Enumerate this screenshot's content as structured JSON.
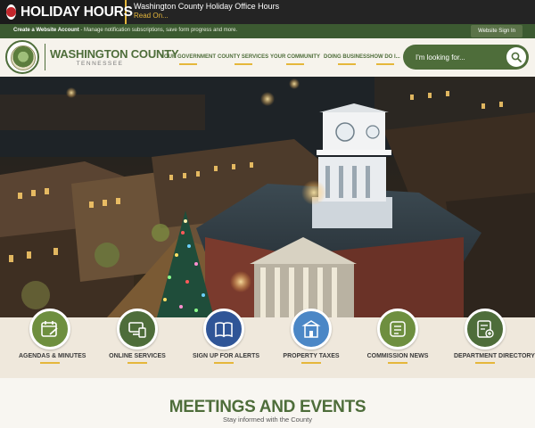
{
  "alert": {
    "title": "HOLIDAY HOURS",
    "message": "Washington County Holiday Office Hours",
    "link": "Read On..."
  },
  "account_bar": {
    "cta": "Create a Website Account",
    "message": " - Manage notification subscriptions, save form progress and more.",
    "signin": "Website Sign In"
  },
  "logo": {
    "name": "WASHINGTON COUNTY",
    "state": "TENNESSEE",
    "seal_icon": "county-seal-icon"
  },
  "nav": [
    "YOUR GOVERNMENT",
    "COUNTY SERVICES",
    "YOUR COMMUNITY",
    "DOING BUSINESS",
    "HOW DO I..."
  ],
  "search": {
    "placeholder": "I'm looking for...",
    "icon": "search-icon"
  },
  "quick_links": [
    {
      "label": "AGENDAS & MINUTES",
      "icon": "calendar-edit-icon",
      "color": "#6e8f3f"
    },
    {
      "label": "ONLINE SERVICES",
      "icon": "online-services-icon",
      "color": "#4e6d3a"
    },
    {
      "label": "SIGN UP FOR ALERTS",
      "icon": "book-icon",
      "color": "#2f5597"
    },
    {
      "label": "PROPERTY TAXES",
      "icon": "building-icon",
      "color": "#4b87c6"
    },
    {
      "label": "COMMISSION NEWS",
      "icon": "news-icon",
      "color": "#6e8f3f"
    },
    {
      "label": "DEPARTMENT DIRECTORY",
      "icon": "directory-icon",
      "color": "#4e6d3a"
    }
  ],
  "meetings": {
    "title": "MEETINGS AND EVENTS",
    "subtitle": "Stay informed with the County"
  },
  "colors": {
    "brand_green": "#4e6d3a",
    "accent_gold": "#e5b73b",
    "alert_red": "#c3262c"
  }
}
